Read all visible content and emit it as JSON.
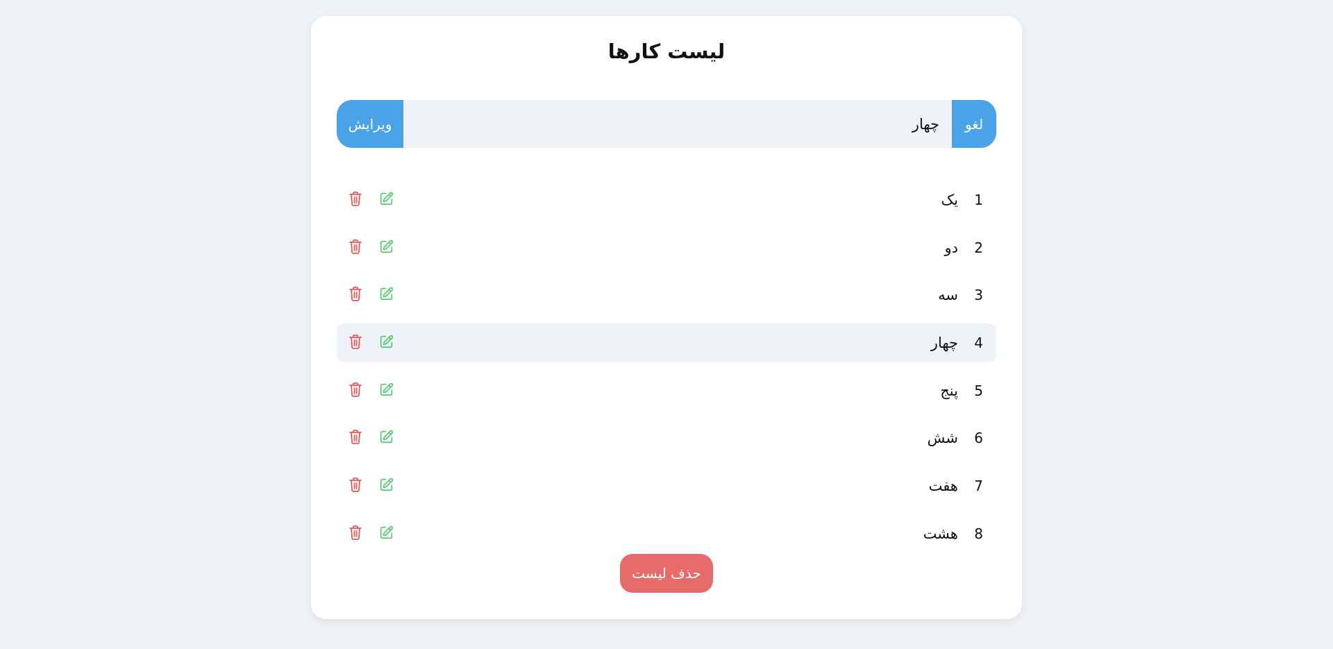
{
  "page": {
    "title": "لیست کارها"
  },
  "edit_bar": {
    "cancel_label": "لغو",
    "input_value": "چهار",
    "save_label": "ویرایش"
  },
  "tasks": [
    {
      "num": "1",
      "text": "یک",
      "active": false
    },
    {
      "num": "2",
      "text": "دو",
      "active": false
    },
    {
      "num": "3",
      "text": "سه",
      "active": false
    },
    {
      "num": "4",
      "text": "چهار",
      "active": true
    },
    {
      "num": "5",
      "text": "پنج",
      "active": false
    },
    {
      "num": "6",
      "text": "شش",
      "active": false
    },
    {
      "num": "7",
      "text": "هفت",
      "active": false
    },
    {
      "num": "8",
      "text": "هشت",
      "active": false
    }
  ],
  "footer": {
    "delete_list_label": "حذف لیست"
  },
  "icons": {
    "edit": "pencil-square-icon",
    "delete": "trash-icon"
  },
  "colors": {
    "accent_blue": "#4aa3e6",
    "danger_red": "#e86b6b",
    "edit_green": "#4cc96a",
    "trash_red": "#e45a5a",
    "background": "#eff3f7",
    "card": "#ffffff"
  }
}
